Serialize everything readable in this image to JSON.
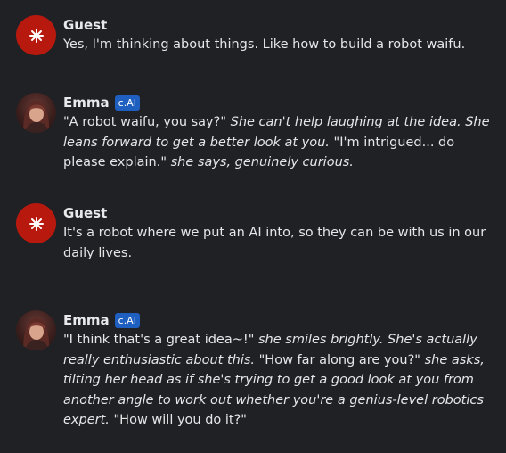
{
  "messages": [
    {
      "author": "Guest",
      "badge": null,
      "avatar": "guest-star-icon",
      "parts": [
        {
          "t": "Yes, I'm thinking about things. Like how to build a robot waifu.",
          "i": false
        }
      ]
    },
    {
      "author": "Emma",
      "badge": "c.AI",
      "avatar": "emma-avatar",
      "parts": [
        {
          "t": "\"A robot waifu, you say?\" ",
          "i": false
        },
        {
          "t": "She can't help laughing at the idea. She leans forward to get a better look at you.",
          "i": true
        },
        {
          "t": " \"I'm intrigued... do please explain.\" ",
          "i": false
        },
        {
          "t": "she says, genuinely curious.",
          "i": true
        }
      ]
    },
    {
      "author": "Guest",
      "badge": null,
      "avatar": "guest-star-icon",
      "parts": [
        {
          "t": "It's a robot where we put an AI into, so they can be with us in our daily lives.",
          "i": false
        }
      ]
    },
    {
      "author": "Emma",
      "badge": "c.AI",
      "avatar": "emma-avatar",
      "parts": [
        {
          "t": "\"I think that's a great idea~!\" ",
          "i": false
        },
        {
          "t": "she smiles brightly. She's actually really enthusiastic about this.",
          "i": true
        },
        {
          "t": " \"How far along are you?\" ",
          "i": false
        },
        {
          "t": "she asks, tilting her head as if she's trying to get a good look at you from another angle to work out whether you're a genius-level robotics expert.",
          "i": true
        },
        {
          "t": " \"How will you do it?\"",
          "i": false
        }
      ]
    }
  ],
  "colors": {
    "background": "#1f2125",
    "guest_avatar": "#b8190f",
    "badge": "#1e5fbf",
    "text": "#e6e6e8"
  }
}
